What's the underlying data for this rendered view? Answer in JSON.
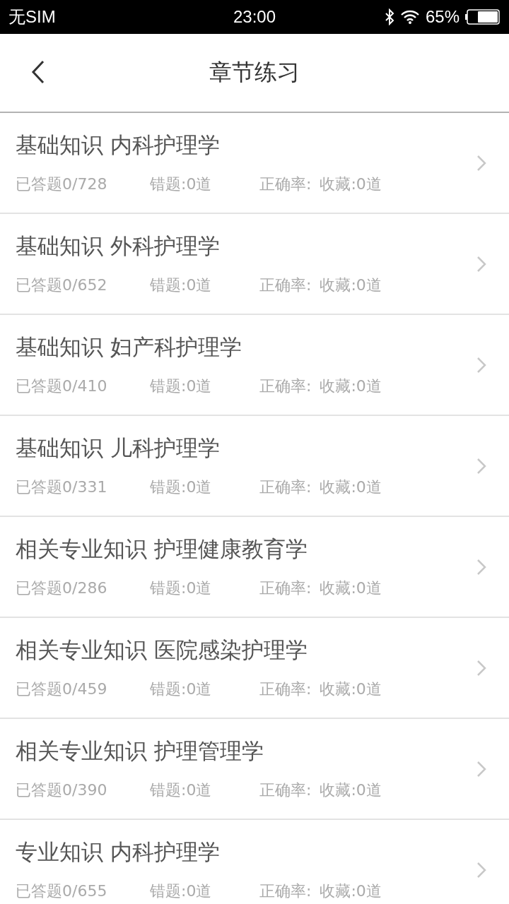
{
  "status_bar": {
    "carrier": "无SIM",
    "time": "23:00",
    "battery": "65%"
  },
  "header": {
    "title": "章节练习"
  },
  "chapters": [
    {
      "title": "基础知识 内科护理学",
      "answered": "已答题0/728",
      "wrong": "错题:0道",
      "accuracy": "正确率:",
      "favorites": "收藏:0道"
    },
    {
      "title": "基础知识 外科护理学",
      "answered": "已答题0/652",
      "wrong": "错题:0道",
      "accuracy": "正确率:",
      "favorites": "收藏:0道"
    },
    {
      "title": "基础知识 妇产科护理学",
      "answered": "已答题0/410",
      "wrong": "错题:0道",
      "accuracy": "正确率:",
      "favorites": "收藏:0道"
    },
    {
      "title": "基础知识 儿科护理学",
      "answered": "已答题0/331",
      "wrong": "错题:0道",
      "accuracy": "正确率:",
      "favorites": "收藏:0道"
    },
    {
      "title": "相关专业知识 护理健康教育学",
      "answered": "已答题0/286",
      "wrong": "错题:0道",
      "accuracy": "正确率:",
      "favorites": "收藏:0道"
    },
    {
      "title": "相关专业知识 医院感染护理学",
      "answered": "已答题0/459",
      "wrong": "错题:0道",
      "accuracy": "正确率:",
      "favorites": "收藏:0道"
    },
    {
      "title": "相关专业知识 护理管理学",
      "answered": "已答题0/390",
      "wrong": "错题:0道",
      "accuracy": "正确率:",
      "favorites": "收藏:0道"
    },
    {
      "title": "专业知识 内科护理学",
      "answered": "已答题0/655",
      "wrong": "错题:0道",
      "accuracy": "正确率:",
      "favorites": "收藏:0道"
    }
  ]
}
